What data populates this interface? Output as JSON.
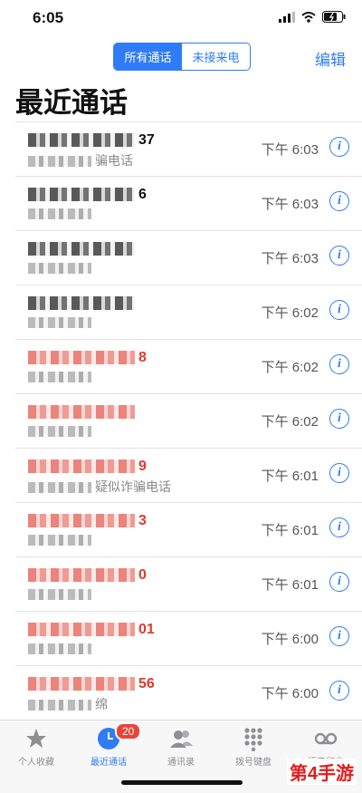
{
  "status": {
    "time": "6:05"
  },
  "nav": {
    "seg_all": "所有通话",
    "seg_missed": "未接来电",
    "edit": "编辑"
  },
  "page_title": "最近通话",
  "calls": [
    {
      "number_tail": "37",
      "note": "骗电话",
      "time": "下午 6:03",
      "missed": false
    },
    {
      "number_tail": "6",
      "note": "",
      "time": "下午 6:03",
      "missed": false
    },
    {
      "number_tail": "",
      "note": "",
      "time": "下午 6:03",
      "missed": false
    },
    {
      "number_tail": "",
      "note": "",
      "time": "下午 6:02",
      "missed": false
    },
    {
      "number_tail": "8",
      "note": "",
      "time": "下午 6:02",
      "missed": true
    },
    {
      "number_tail": "",
      "note": "",
      "time": "下午 6:02",
      "missed": true
    },
    {
      "number_tail": "9",
      "note": "疑似诈骗电话",
      "time": "下午 6:01",
      "missed": true
    },
    {
      "number_tail": "3",
      "note": "",
      "time": "下午 6:01",
      "missed": true
    },
    {
      "number_tail": "0",
      "note": "",
      "time": "下午 6:01",
      "missed": true
    },
    {
      "number_tail": "01",
      "note": "",
      "time": "下午 6:00",
      "missed": true
    },
    {
      "number_tail": "56",
      "note": "绵",
      "time": "下午 6:00",
      "missed": true
    }
  ],
  "tabs": [
    {
      "label": "个人收藏",
      "icon": "star-icon"
    },
    {
      "label": "最近通话",
      "icon": "clock-icon"
    },
    {
      "label": "通讯录",
      "icon": "contacts-icon"
    },
    {
      "label": "拨号键盘",
      "icon": "keypad-icon"
    },
    {
      "label": "语音留言",
      "icon": "voicemail-icon"
    }
  ],
  "recents_badge": "20",
  "watermark": "第4手游",
  "colors": {
    "accent": "#2f7cf6",
    "missed": "#e03a2f",
    "badge": "#e8443a"
  }
}
